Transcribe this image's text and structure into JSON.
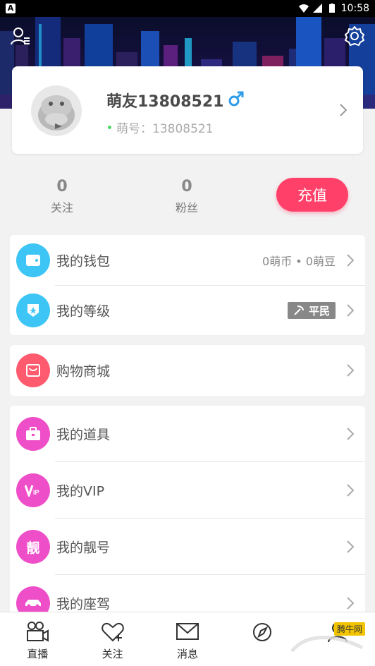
{
  "statusbar": {
    "left_badge": "A",
    "time": "10:58"
  },
  "profile": {
    "nickname": "萌友13808521",
    "gender_icon": "male-icon",
    "id_text": "萌号：13808521"
  },
  "stats": [
    {
      "value": "0",
      "label": "关注"
    },
    {
      "value": "0",
      "label": "粉丝"
    }
  ],
  "recharge_label": "充值",
  "groups": {
    "g1": [
      {
        "label": "我的钱包",
        "value": "0萌币 • 0萌豆",
        "icon": "wallet-icon",
        "color": "#3dc5f5"
      },
      {
        "label": "我的等级",
        "badge": "平民",
        "icon": "level-icon",
        "color": "#3dc5f5"
      }
    ],
    "g2": [
      {
        "label": "购物商城",
        "icon": "shop-bag-icon",
        "color": "#ff5a6e"
      }
    ],
    "g3": [
      {
        "label": "我的道具",
        "icon": "props-icon",
        "color": "#ee4fc9"
      },
      {
        "label": "我的VIP",
        "icon": "vip-icon",
        "color": "#ee4fc9"
      },
      {
        "label": "我的靓号",
        "icon": "pretty-number-icon",
        "glyph": "靓",
        "color": "#ee4fc9"
      },
      {
        "label": "我的座驾",
        "icon": "car-icon",
        "color": "#ee4fc9"
      }
    ]
  },
  "bottom_nav": [
    {
      "label": "直播",
      "icon": "live-camera-icon"
    },
    {
      "label": "关注",
      "icon": "follow-heart-icon"
    },
    {
      "label": "消息",
      "icon": "message-envelope-icon"
    },
    {
      "label": "",
      "icon": "discover-icon"
    },
    {
      "label": "",
      "icon": "me-icon"
    }
  ],
  "watermark": "腾牛网",
  "colors": {
    "accent": "#ff4169",
    "text": "#555555"
  }
}
